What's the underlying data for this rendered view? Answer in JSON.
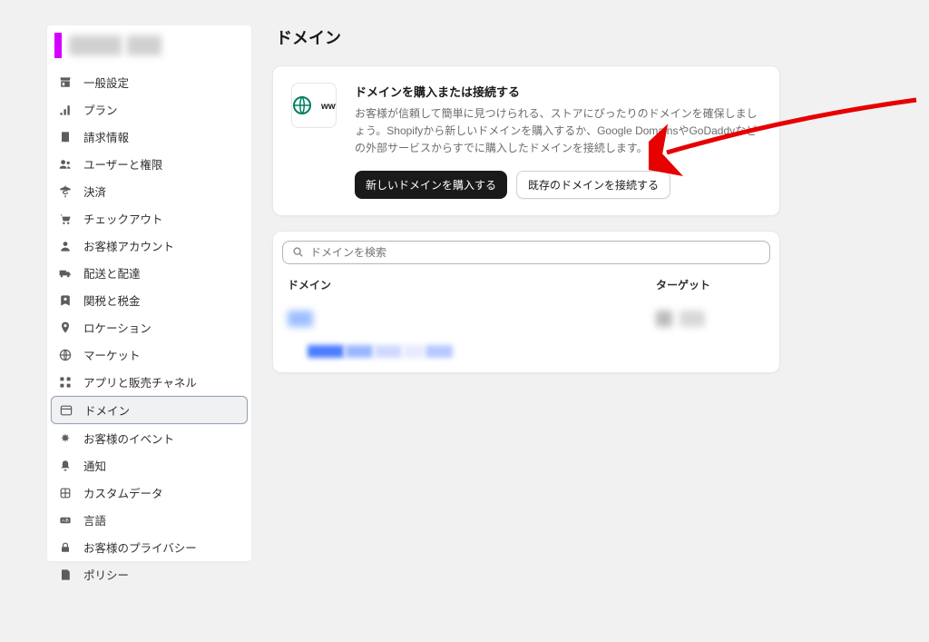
{
  "page": {
    "title": "ドメイン"
  },
  "sidebar": {
    "items": [
      {
        "label": "一般設定",
        "icon": "store"
      },
      {
        "label": "プラン",
        "icon": "plan"
      },
      {
        "label": "請求情報",
        "icon": "billing"
      },
      {
        "label": "ユーザーと権限",
        "icon": "users"
      },
      {
        "label": "決済",
        "icon": "payments"
      },
      {
        "label": "チェックアウト",
        "icon": "checkout"
      },
      {
        "label": "お客様アカウント",
        "icon": "account"
      },
      {
        "label": "配送と配達",
        "icon": "shipping"
      },
      {
        "label": "関税と税金",
        "icon": "taxes"
      },
      {
        "label": "ロケーション",
        "icon": "location"
      },
      {
        "label": "マーケット",
        "icon": "markets"
      },
      {
        "label": "アプリと販売チャネル",
        "icon": "apps"
      },
      {
        "label": "ドメイン",
        "icon": "domains",
        "active": true
      },
      {
        "label": "お客様のイベント",
        "icon": "events"
      },
      {
        "label": "通知",
        "icon": "notifications"
      },
      {
        "label": "カスタムデータ",
        "icon": "customdata"
      },
      {
        "label": "言語",
        "icon": "languages"
      },
      {
        "label": "お客様のプライバシー",
        "icon": "privacy"
      },
      {
        "label": "ポリシー",
        "icon": "policies"
      }
    ]
  },
  "hero": {
    "title": "ドメインを購入または接続する",
    "desc": "お客様が信頼して簡単に見つけられる、ストアにぴったりのドメインを確保しましょう。Shopifyから新しいドメインを購入するか、Google DomainsやGoDaddyなどの外部サービスからすでに購入したドメインを接続します。",
    "primary_btn": "新しいドメインを購入する",
    "secondary_btn": "既存のドメインを接続する",
    "icon_text": "www"
  },
  "search": {
    "placeholder": "ドメインを検索"
  },
  "table": {
    "col_domain": "ドメイン",
    "col_target": "ターゲット"
  }
}
